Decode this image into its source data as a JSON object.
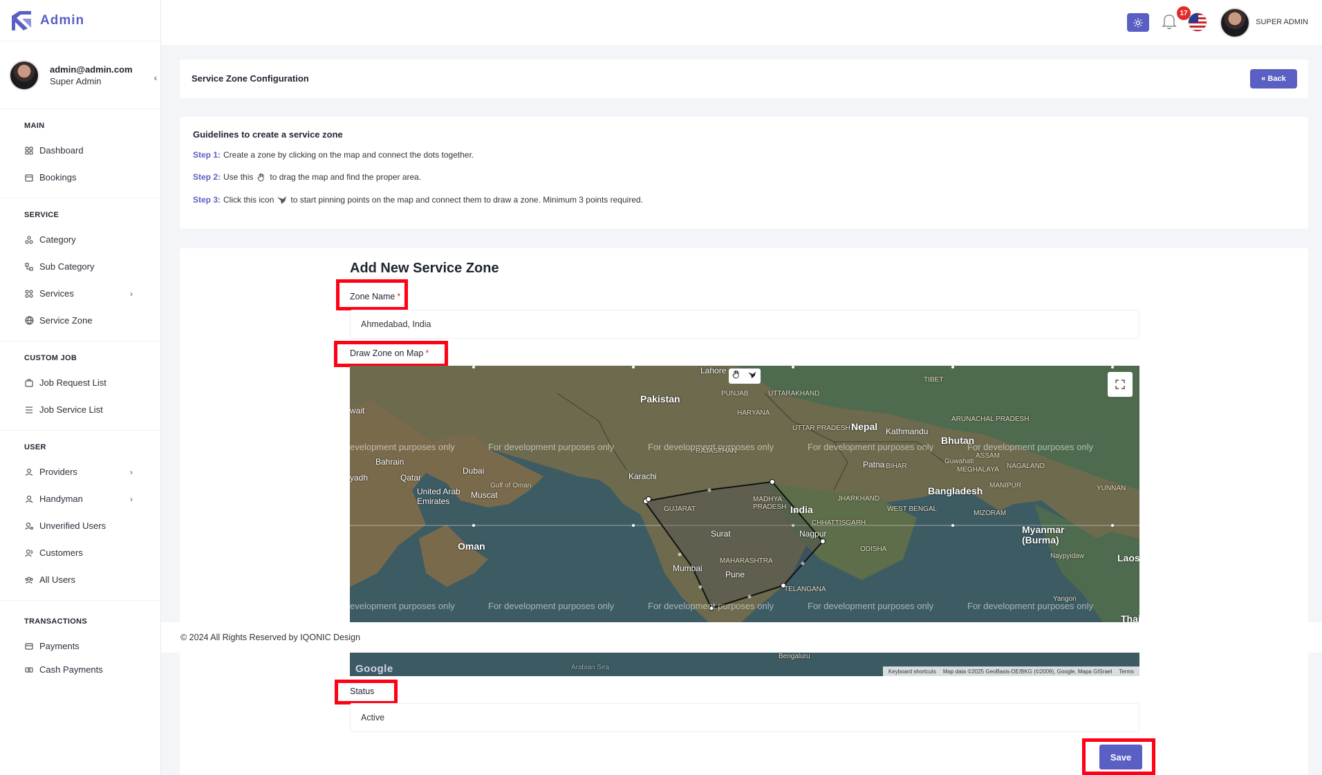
{
  "brand": {
    "name": "Admin"
  },
  "user": {
    "email": "admin@admin.com",
    "role": "Super Admin"
  },
  "header": {
    "notifications_count": "17",
    "user_label": "SUPER ADMIN"
  },
  "sidebar": {
    "sections": [
      {
        "title": "MAIN",
        "items": [
          "Dashboard",
          "Bookings"
        ]
      },
      {
        "title": "SERVICE",
        "items": [
          "Category",
          "Sub Category",
          "Services",
          "Service Zone"
        ]
      },
      {
        "title": "CUSTOM JOB",
        "items": [
          "Job Request List",
          "Job Service List"
        ]
      },
      {
        "title": "USER",
        "items": [
          "Providers",
          "Handyman",
          "Unverified Users",
          "Customers",
          "All Users"
        ]
      },
      {
        "title": "TRANSACTIONS",
        "items": [
          "Payments",
          "Cash Payments"
        ]
      }
    ]
  },
  "page": {
    "title": "Service Zone Configuration",
    "back_label": "Back"
  },
  "guide": {
    "title": "Guidelines to create a service zone",
    "step1_label": "Step 1:",
    "step1_text": "Create a zone by clicking on the map and connect the dots together.",
    "step2_label": "Step 2:",
    "step2_text_a": "Use this",
    "step2_text_b": "to drag the map and find the proper area.",
    "step3_label": "Step 3:",
    "step3_text_a": "Click this icon",
    "step3_text_b": "to start pinning points on the map and connect them to draw a zone. Minimum 3 points required."
  },
  "form": {
    "title": "Add New Service Zone",
    "zone_name_label": "Zone Name",
    "zone_name_value": "Ahmedabad, India",
    "draw_label": "Draw Zone on Map",
    "status_label": "Status",
    "status_value": "Active",
    "required_mark": "*",
    "save_label": "Save"
  },
  "map": {
    "dev_watermark": "For development purposes only",
    "dev_watermark_cut": "evelopment purposes only",
    "labels": {
      "pakistan": "Pakistan",
      "nepal": "Nepal",
      "kathmandu": "Kathmandu",
      "bhutan": "Bhutan",
      "tibet": "TIBET",
      "lahore": "Lahore",
      "punjab": "PUNJAB",
      "haryana": "HARYANA",
      "uttarakhand": "UTTARAKHAND",
      "uttar_pradesh": "UTTAR PRADESH",
      "rajasthan": "RAJASTHAN",
      "bahrain": "Bahrain",
      "qatar": "Qatar",
      "dubai": "Dubai",
      "uae": "United Arab Emirates",
      "muscat": "Muscat",
      "oman": "Oman",
      "karachi": "Karachi",
      "gujarat": "GUJARAT",
      "madhya_pradesh": "MADHYA PRADESH",
      "india": "India",
      "chhattisgarh": "CHHATTISGARH",
      "surat": "Surat",
      "nagpur": "Nagpur",
      "maharashtra": "MAHARASHTRA",
      "mumbai": "Mumbai",
      "pune": "Pune",
      "telangana": "TELANGANA",
      "odisha": "ODISHA",
      "jharkhand": "JHARKHAND",
      "west_bengal": "WEST BENGAL",
      "bihar": "BIHAR",
      "patna": "Patna",
      "bangladesh": "Bangladesh",
      "assam": "ASSAM",
      "guwahati": "Guwahati",
      "meghalaya": "MEGHALAYA",
      "nagaland": "NAGALAND",
      "manipur": "MANIPUR",
      "mizoram": "MIZORAM",
      "arunachal": "ARUNACHAL PRADESH",
      "myanmar": "Myanmar (Burma)",
      "yunnan": "YUNNAN",
      "laos": "Laos",
      "naypyidaw": "Naypyidaw",
      "yangon": "Yangon",
      "thai": "Thail",
      "gulf_of_oman": "Gulf of Oman",
      "wait": "wait",
      "yadh": "yadh",
      "bengaluru": "Bengaluru",
      "arabian_sea": "Arabian Sea"
    },
    "keyboard_shortcuts": "Keyboard shortcuts",
    "map_data": "Map data ©2025 GeoBasis-DE/BKG (©2009), Google, Mapa GISrael",
    "terms": "Terms",
    "google": "Google"
  },
  "footer": {
    "text": "© 2024 All Rights Reserved by IQONIC Design"
  },
  "colors": {
    "accent": "#5a5fc3",
    "highlight": "#ff0014",
    "badge": "#e22a2a"
  }
}
